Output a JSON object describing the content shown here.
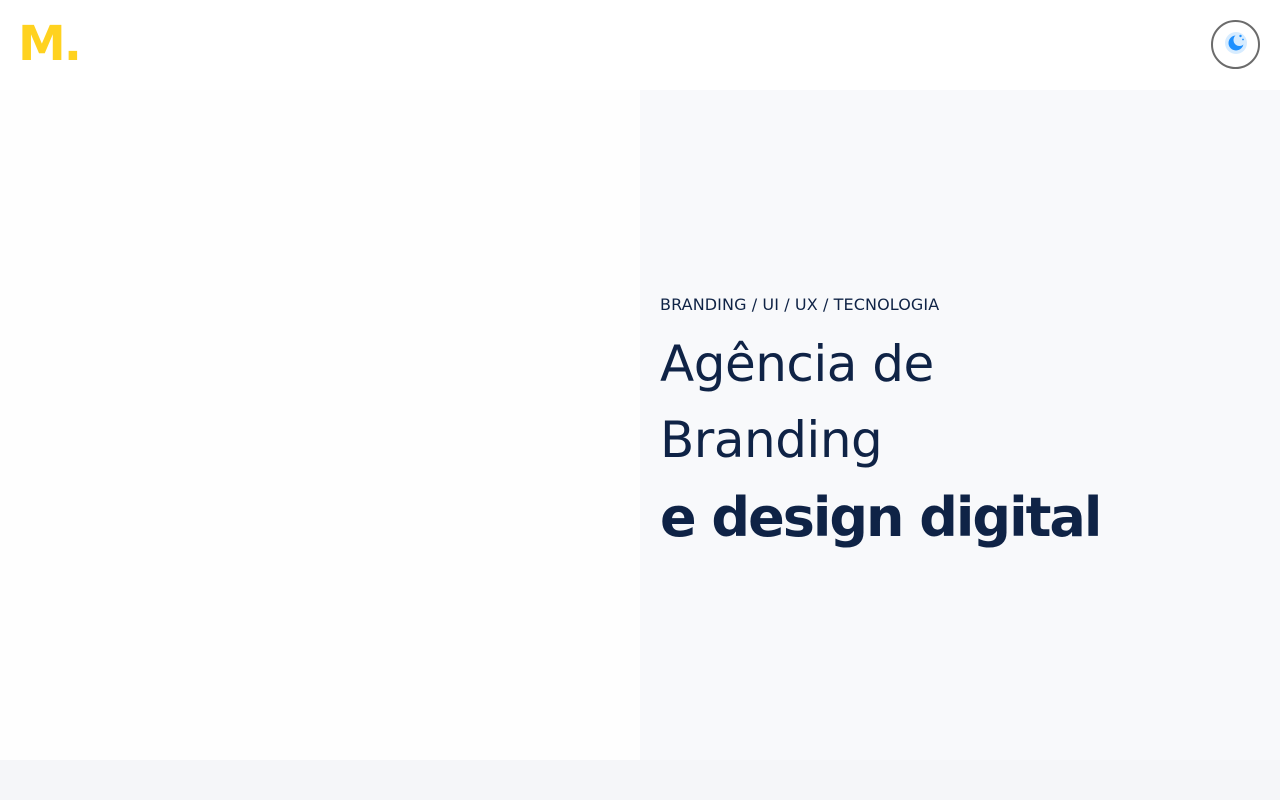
{
  "header": {
    "logo_text": "M.",
    "theme_toggle_icon": "moon-icon",
    "colors": {
      "logo": "#ffd21f",
      "toggle_border": "#6b6b6b",
      "toggle_icon": "#1e90ff"
    }
  },
  "hero": {
    "eyebrow": "BRANDING / UI / UX / TECNOLOGIA",
    "headline_line1": "Agência de",
    "headline_line2": "Branding",
    "headline_line3": "e design digital",
    "colors": {
      "text": "#0f2346",
      "right_panel_bg": "#f8f9fb"
    }
  }
}
